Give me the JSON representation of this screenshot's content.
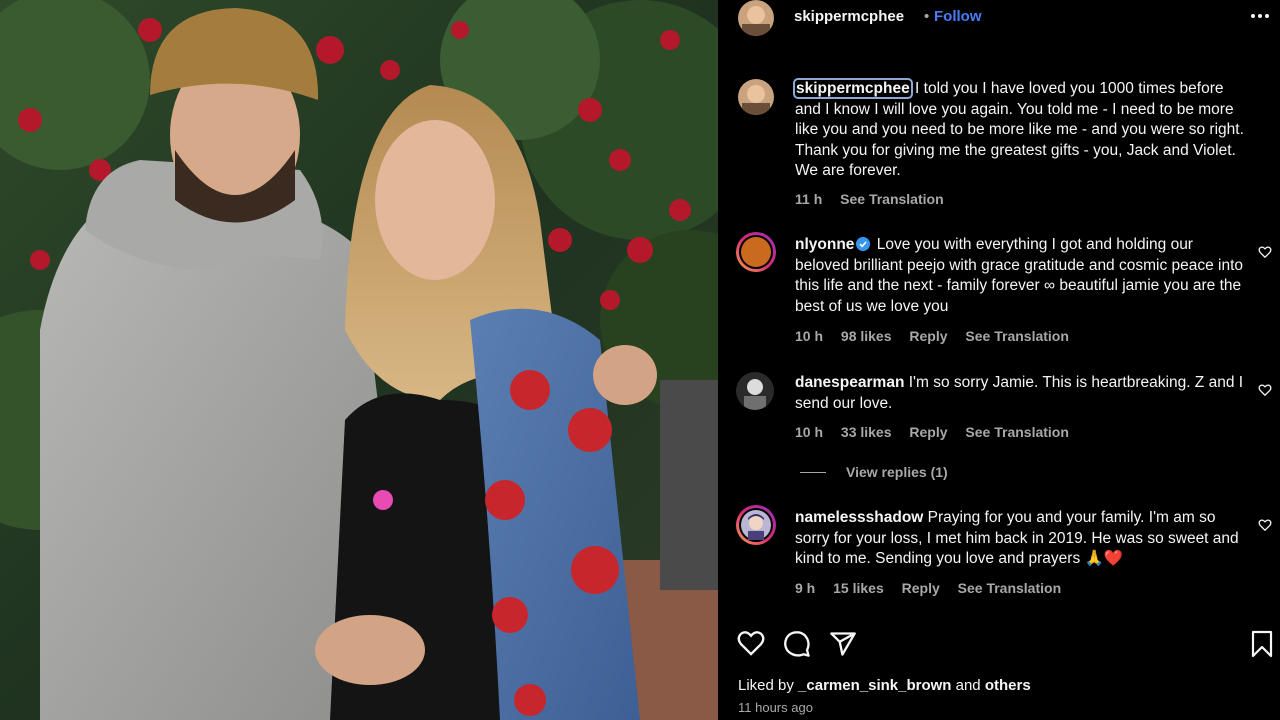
{
  "post": {
    "author": "skippermcphee",
    "follow_label": "Follow",
    "more_label": "•••"
  },
  "caption": {
    "author": "skippermcphee",
    "text": "I told you I have loved you 1000 times before and I know I will love you again. You told me - I need to be more like you and you need to be more like me - and you were so right. Thank you for giving me the greatest gifts - you, Jack and Violet. We are forever.",
    "time": "11 h",
    "translation": "See Translation"
  },
  "comments": [
    {
      "author": "nlyonne",
      "text": "Love you with everything I got and holding our beloved brilliant peejo with grace gratitude and cosmic peace into this life and the next - family forever ∞ beautiful jamie you are the best of us we love you",
      "time": "10 h",
      "likes": "98 likes",
      "reply": "Reply",
      "translation": "See Translation"
    },
    {
      "author": "danespearman",
      "text": "I'm so sorry Jamie. This is heartbreaking. Z and I send our love.",
      "time": "10 h",
      "likes": "33 likes",
      "reply": "Reply",
      "translation": "See Translation",
      "view_replies": "View replies (1)"
    },
    {
      "author": "namelessshadow",
      "text": "Praying for you and your family. I'm am so sorry for your loss, I met him back in 2019. He was so sweet and kind to me. Sending you love and prayers 🙏❤️",
      "time": "9 h",
      "likes": "15 likes",
      "reply": "Reply",
      "translation": "See Translation"
    }
  ],
  "footer": {
    "liked_by_prefix": "Liked by",
    "liked_by_user": "_carmen_sink_brown",
    "liked_by_and": "and",
    "liked_by_others": "others",
    "timestamp": "11 hours ago"
  },
  "icons": {
    "like": "heart-icon",
    "comment": "comment-icon",
    "share": "send-icon",
    "save": "bookmark-icon",
    "more": "more-icon",
    "verified": "verified-badge-icon"
  },
  "colors": {
    "follow": "#4a7cf6",
    "verified": "#3797f0",
    "muted": "#a8a8a8",
    "background": "#000000"
  }
}
